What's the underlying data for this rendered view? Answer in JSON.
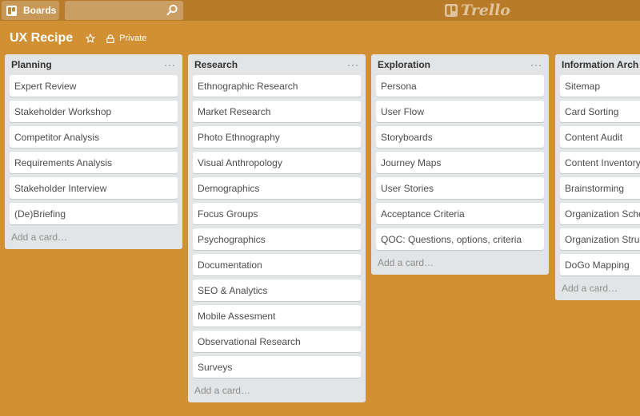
{
  "topbar": {
    "boards_label": "Boards",
    "search_value": "",
    "logo_text": "Trello"
  },
  "board": {
    "title": "UX Recipe",
    "privacy": "Private"
  },
  "lists": [
    {
      "title": "Planning",
      "cards": [
        "Expert Review",
        "Stakeholder Workshop",
        "Competitor Analysis",
        "Requirements Analysis",
        "Stakeholder Interview",
        "(De)Briefing"
      ],
      "add_label": "Add a card…"
    },
    {
      "title": "Research",
      "cards": [
        "Ethnographic Research",
        "Market Research",
        "Photo Ethnography",
        "Visual Anthropology",
        "Demographics",
        "Focus Groups",
        "Psychographics",
        "Documentation",
        "SEO & Analytics",
        "Mobile Assesment",
        "Observational Research",
        "Surveys"
      ],
      "add_label": "Add a card…"
    },
    {
      "title": "Exploration",
      "cards": [
        "Persona",
        "User Flow",
        "Storyboards",
        "Journey Maps",
        "User Stories",
        "Acceptance Criteria",
        "QOC: Questions, options, criteria"
      ],
      "add_label": "Add a card…"
    },
    {
      "title": "Information Architecture",
      "cards": [
        "Sitemap",
        "Card Sorting",
        "Content Audit",
        "Content Inventory",
        "Brainstorming",
        "Organization Schemes",
        "Organization Structures",
        "DoGo Mapping"
      ],
      "add_label": "Add a card…"
    }
  ],
  "colors": {
    "board_background": "#d29034",
    "topbar": "#b87b28",
    "list_background": "#e2e4e6",
    "card": "#ffffff"
  }
}
